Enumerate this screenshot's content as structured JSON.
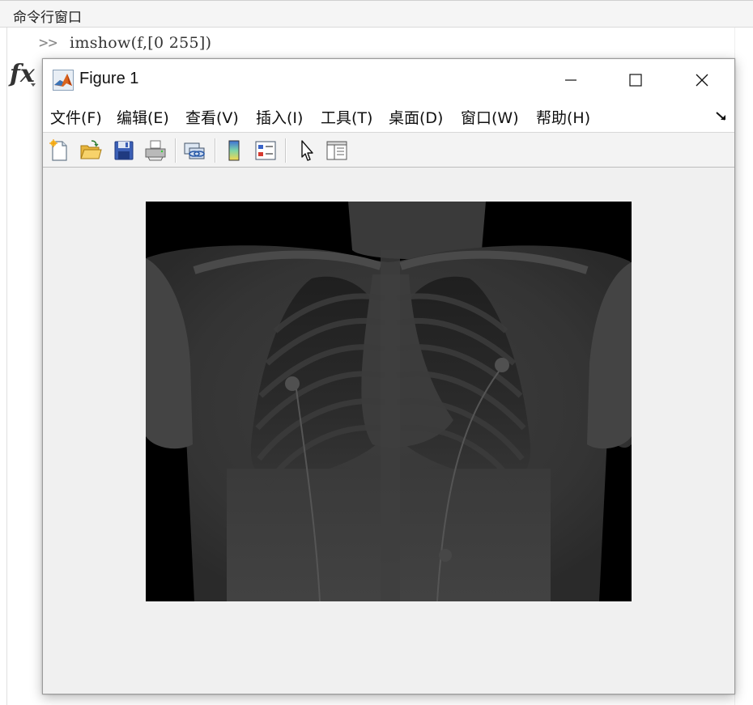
{
  "command_window": {
    "title": "命令行窗口",
    "prompt": ">>",
    "input": "imshow(f,[0 255])",
    "fx_label": "fx"
  },
  "figure": {
    "title": "Figure 1",
    "icon": "matlab-logo-icon",
    "window_controls": [
      "minimize-icon",
      "maximize-icon",
      "close-icon"
    ],
    "menu": [
      {
        "label": "文件(F)"
      },
      {
        "label": "编辑(E)"
      },
      {
        "label": "查看(V)"
      },
      {
        "label": "插入(I)"
      },
      {
        "label": "工具(T)"
      },
      {
        "label": "桌面(D)"
      },
      {
        "label": "窗口(W)"
      },
      {
        "label": "帮助(H)"
      }
    ],
    "toolbar": [
      "new-figure-icon",
      "open-file-icon",
      "save-icon",
      "print-icon",
      "link-plot-icon",
      "insert-colorbar-icon",
      "insert-legend-icon",
      "edit-plot-arrow-icon",
      "property-inspector-icon"
    ],
    "image": {
      "description_icon": "chest-xray-image",
      "display_range": [
        0,
        255
      ]
    }
  }
}
